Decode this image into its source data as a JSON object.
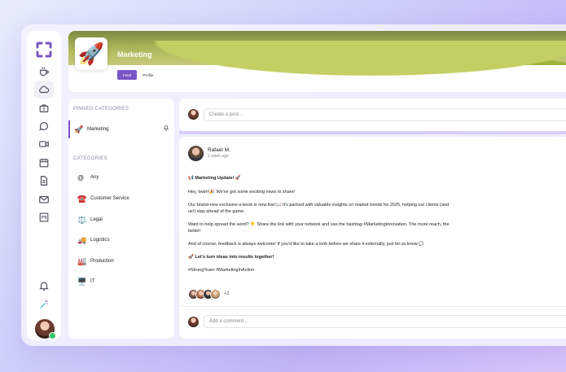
{
  "sidebar": {
    "logo": "app-logo",
    "items": [
      {
        "name": "coffee-icon"
      },
      {
        "name": "cloud-icon"
      },
      {
        "name": "briefcase-icon"
      },
      {
        "name": "chat-icon"
      },
      {
        "name": "video-icon"
      },
      {
        "name": "calendar-icon"
      },
      {
        "name": "document-icon"
      },
      {
        "name": "mail-icon"
      },
      {
        "name": "board-icon"
      }
    ],
    "bottom": [
      {
        "name": "bell-icon"
      },
      {
        "name": "magic-wand-icon"
      }
    ]
  },
  "group": {
    "title": "Marketing",
    "emoji": "🚀",
    "tabs": [
      "Feed",
      "Profile"
    ]
  },
  "categories": {
    "pinned_label": "PINNED CATEGORIES",
    "pinned": [
      {
        "emoji": "🚀",
        "label": "Marketing"
      }
    ],
    "all_label": "CATEGORIES",
    "items": [
      {
        "emoji": "@",
        "label": "Any"
      },
      {
        "emoji": "☎️",
        "label": "Customer Service"
      },
      {
        "emoji": "⚖️",
        "label": "Legal"
      },
      {
        "emoji": "🚚",
        "label": "Logistics"
      },
      {
        "emoji": "🏭",
        "label": "Production"
      },
      {
        "emoji": "🖥️",
        "label": "IT"
      }
    ]
  },
  "create_post": {
    "placeholder": "Create a post..."
  },
  "post": {
    "author": "Rafael M.",
    "time": "1 week ago",
    "headline": "Marketing Update!",
    "headline_prefix": "📢",
    "headline_suffix": "🚀",
    "p1": "Hey, team!🎉 We've got some exciting news to share!",
    "p2": "Our brand-new exclusive e-book is now live!📖 It's packed with valuable insights on market trends for 2025, helping our clients (and us!) stay ahead of the game.",
    "p3": "Want to help spread the word? 👇 Share the link with your network and use the hashtag #MarketingInnovation. The more reach, the better!",
    "p4": "And of course, feedback is always welcome! If you'd like to take a look before we share it externally, just let us know.💬",
    "cta": "Let's turn ideas into results together!",
    "cta_prefix": "🚀",
    "tags": "#StrongTeam #MarketingInAction",
    "reaction_more": "+2",
    "comment_placeholder": "Add a comment..."
  }
}
